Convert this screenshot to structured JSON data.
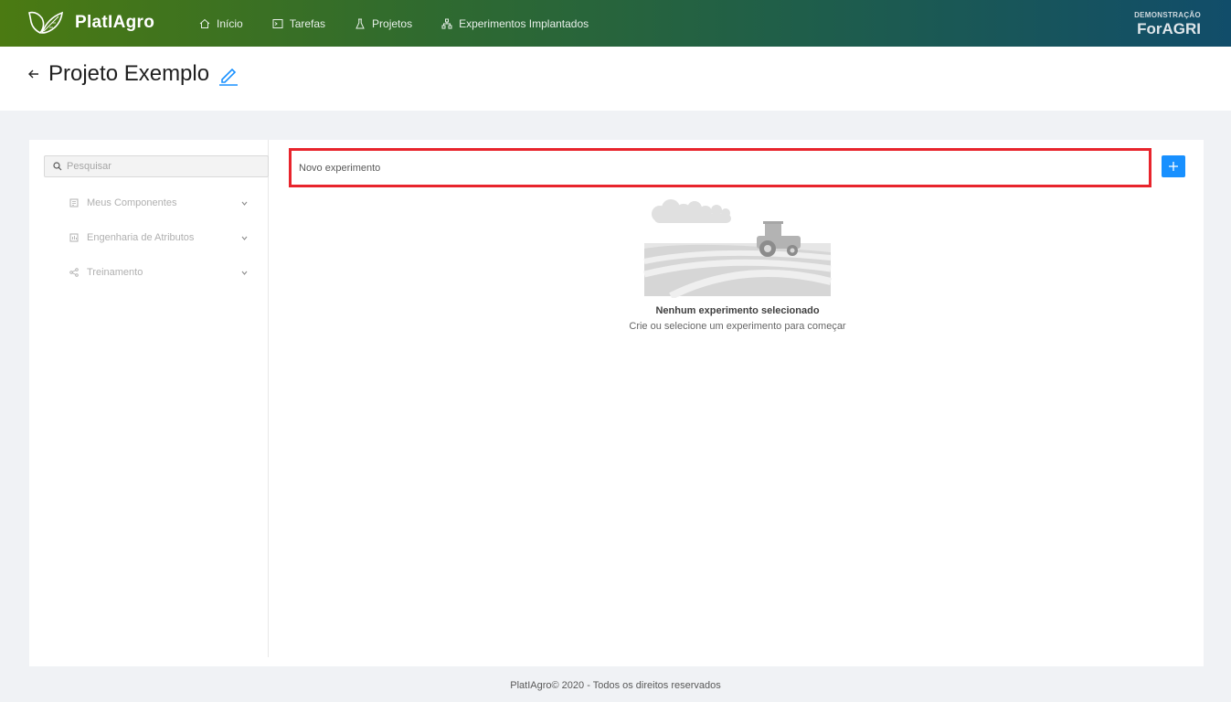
{
  "app": {
    "logo_text": "PlatIAgro",
    "brand_label": "DEMONSTRAÇÃO",
    "brand_name": "ForAGRI"
  },
  "nav": {
    "items": [
      {
        "label": "Início",
        "icon": "home-icon"
      },
      {
        "label": "Tarefas",
        "icon": "terminal-icon"
      },
      {
        "label": "Projetos",
        "icon": "flask-icon"
      },
      {
        "label": "Experimentos Implantados",
        "icon": "cluster-icon"
      }
    ]
  },
  "page": {
    "title": "Projeto Exemplo"
  },
  "sidebar": {
    "search_placeholder": "Pesquisar",
    "items": [
      {
        "label": "Meus Componentes",
        "icon": "component-icon"
      },
      {
        "label": "Engenharia de Atributos",
        "icon": "table-icon"
      },
      {
        "label": "Treinamento",
        "icon": "share-icon"
      }
    ]
  },
  "experiment": {
    "new_label": "Novo experimento",
    "add_button": "+"
  },
  "empty": {
    "title": "Nenhum experimento selecionado",
    "subtitle": "Crie ou selecione um experimento para começar"
  },
  "footer": {
    "text": "PlatIAgro© 2020 - Todos os direitos reservados"
  },
  "colors": {
    "accent": "#1890ff",
    "highlight": "#e8242c"
  }
}
